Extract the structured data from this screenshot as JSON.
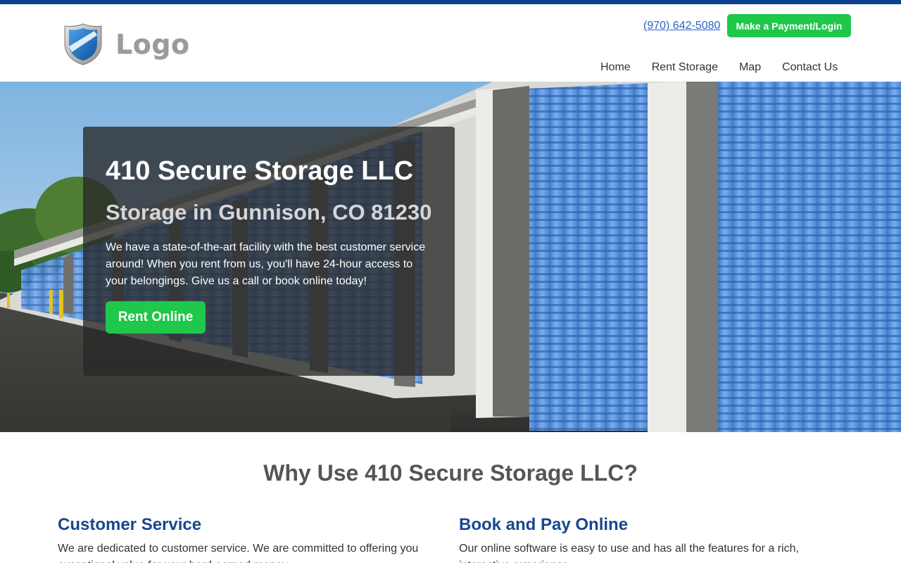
{
  "header": {
    "logo_text": "Logo",
    "phone": "(970) 642-5080",
    "pay_button": "Make a Payment/Login"
  },
  "nav": {
    "items": [
      {
        "label": "Home"
      },
      {
        "label": "Rent Storage"
      },
      {
        "label": "Map"
      },
      {
        "label": "Contact Us"
      }
    ]
  },
  "hero": {
    "title": "410 Secure Storage LLC",
    "subtitle": "Storage in Gunnison, CO 81230",
    "text": "We have a state-of-the-art facility with the best customer service around! When you rent from us, you'll have 24-hour access to your belongings. Give us a call or book online today!",
    "button": "Rent Online"
  },
  "why": {
    "title": "Why Use 410 Secure Storage LLC?",
    "features": [
      {
        "title": "Customer Service",
        "text": "We are dedicated to customer service. We are committed to offering you exceptional value for your hard-earned money."
      },
      {
        "title": "Book and Pay Online",
        "text": "Our online software is easy to use and has all the features for a rich, interactive experience."
      }
    ]
  },
  "colors": {
    "brand_blue": "#0d3f91",
    "accent_green": "#1fc74a",
    "heading_blue": "#17478f",
    "link_blue": "#2a62c9"
  },
  "icons": {
    "logo": "shield-icon"
  }
}
